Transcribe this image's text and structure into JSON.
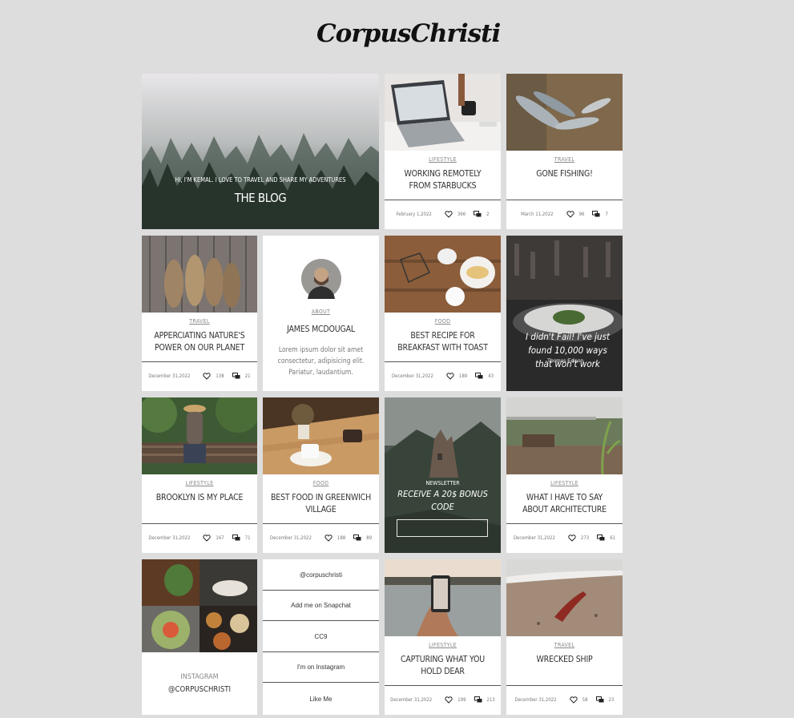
{
  "logo": "CorpusChristi",
  "hero": {
    "subtitle": "HI, I'M KEMAL. I LOVE TO TRAVEL AND SHARE MY ADVENTURES",
    "title": "THE BLOG"
  },
  "posts": [
    {
      "category": "LIFESTYLE",
      "title": "WORKING REMOTELY FROM STARBUCKS",
      "date": "February 1,2022",
      "likes": "366",
      "comments": "2"
    },
    {
      "category": "TRAVEL",
      "title": "GONE FISHING!",
      "date": "March 11,2022",
      "likes": "96",
      "comments": "7"
    },
    {
      "category": "TRAVEL",
      "title": "APPERCIATING NATURE'S POWER ON OUR PLANET",
      "date": "December 31,2022",
      "likes": "138",
      "comments": "21"
    },
    {
      "category": "FOOD",
      "title": "BEST RECIPE FOR BREAKFAST WITH TOAST",
      "date": "December 31,2022",
      "likes": "189",
      "comments": "43"
    },
    {
      "category": "LIFESTYLE",
      "title": "BROOKLYN IS MY PLACE",
      "date": "December 31,2022",
      "likes": "167",
      "comments": "71"
    },
    {
      "category": "FOOD",
      "title": "BEST FOOD IN GREENWICH VILLAGE",
      "date": "December 31,2022",
      "likes": "188",
      "comments": "89"
    },
    {
      "category": "LIFESTYLE",
      "title": "WHAT I HAVE TO SAY ABOUT ARCHITECTURE",
      "date": "December 31,2022",
      "likes": "273",
      "comments": "61"
    },
    {
      "category": "LIFESTYLE",
      "title": "CAPTURING WHAT YOU HOLD DEAR",
      "date": "December 31,2022",
      "likes": "199",
      "comments": "213"
    },
    {
      "category": "TRAVEL",
      "title": "WRECKED SHIP",
      "date": "December 31,2022",
      "likes": "58",
      "comments": "23"
    }
  ],
  "about": {
    "category": "ABOUT",
    "name": "JAMES McDOUGAL",
    "bio": "Lorem ipsum dolor sit amet consectetur, adipisicing elit. Pariatur, laudantium."
  },
  "quote": {
    "text": "I didn't Fail! I've just found 10,000 ways that won't work",
    "author": "-Thomas Edison"
  },
  "newsletter": {
    "label": "NEWSLETTER",
    "headline": "RECEIVE A 20$ BONUS CODE",
    "input_placeholder": ""
  },
  "instagram": {
    "label": "INSTAGRAM",
    "handle": "@CORPUSCHRISTI"
  },
  "social_links": [
    "@corpuschristi",
    "Add me on Snapchat",
    "CC9",
    "I'm on Instagram",
    "Like Me"
  ],
  "icons": {
    "like": "heart-icon",
    "comment": "comment-icon"
  }
}
